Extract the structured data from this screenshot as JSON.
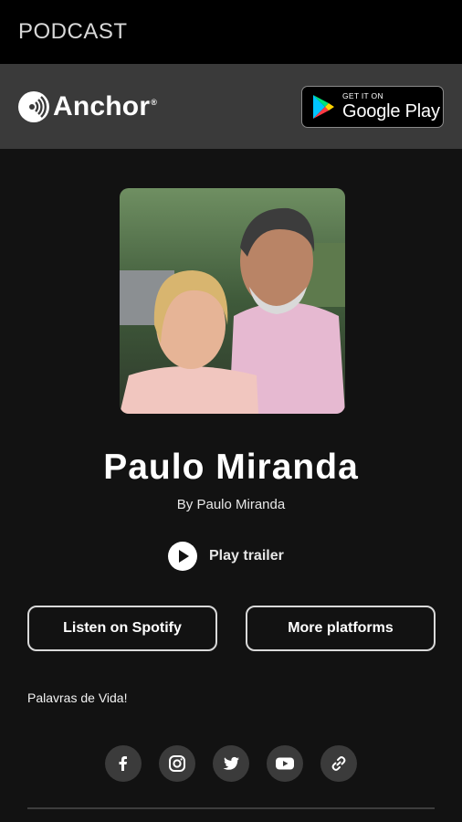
{
  "statusbar": {
    "title": "PODCAST"
  },
  "header": {
    "brand_name": "Anchor",
    "brand_reg": "®",
    "store_badge": {
      "small": "GET IT ON",
      "big": "Google Play"
    }
  },
  "podcast": {
    "title": "Paulo Miranda",
    "author": "By Paulo Miranda",
    "trailer_label": "Play trailer",
    "description": "Palavras de Vida!"
  },
  "buttons": {
    "spotify": "Listen on Spotify",
    "more": "More platforms"
  },
  "socials": [
    "facebook-icon",
    "instagram-icon",
    "twitter-icon",
    "youtube-icon",
    "link-icon"
  ],
  "colors": {
    "background": "#121212",
    "header": "#3a3a3a",
    "statusbar": "#000000",
    "social_bg": "#3b3b3b"
  }
}
